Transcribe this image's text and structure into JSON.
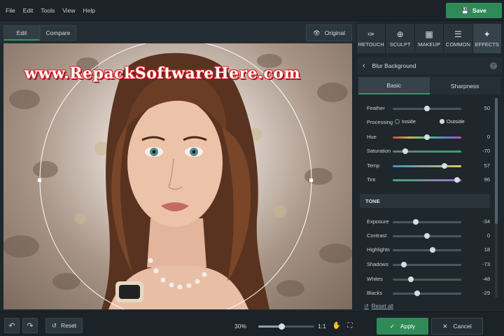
{
  "menu": [
    "File",
    "Edit",
    "Tools",
    "View",
    "Help"
  ],
  "save_label": "Save",
  "mode_tabs": {
    "edit": "Edit",
    "compare": "Compare"
  },
  "original_label": "Original",
  "watermark": "www.RepackSoftwareHere.com",
  "tools": [
    {
      "label": "RETOUCH",
      "icon": "retouch-brush-icon"
    },
    {
      "label": "SCULPT",
      "icon": "sculpt-icon"
    },
    {
      "label": "MAKEUP",
      "icon": "makeup-icon"
    },
    {
      "label": "COMMON",
      "icon": "sliders-icon"
    },
    {
      "label": "EFFECTS",
      "icon": "effects-icon"
    }
  ],
  "panel": {
    "title": "Blur Background",
    "help": "?",
    "subtabs": {
      "basic": "Basic",
      "sharpness": "Sharpness"
    },
    "feather": {
      "label": "Feather",
      "value": "50",
      "pos": 0.5
    },
    "processing": {
      "label": "Processing",
      "inside": "Inside",
      "outside": "Outside",
      "selected": "outside"
    },
    "hue": {
      "label": "Hue",
      "value": "0",
      "pos": 0.5
    },
    "saturation": {
      "label": "Saturation",
      "value": "-70",
      "pos": 0.18
    },
    "temp": {
      "label": "Temp",
      "value": "57",
      "pos": 0.75
    },
    "tint": {
      "label": "Tint",
      "value": "96",
      "pos": 0.94
    },
    "tone_header": "TONE",
    "exposure": {
      "label": "Exposure",
      "value": "-34",
      "pos": 0.34
    },
    "contrast": {
      "label": "Contrast",
      "value": "0",
      "pos": 0.5
    },
    "highlights": {
      "label": "Highlights",
      "value": "18",
      "pos": 0.58
    },
    "shadows": {
      "label": "Shadows",
      "value": "-73",
      "pos": 0.16
    },
    "whites": {
      "label": "Whites",
      "value": "-48",
      "pos": 0.27
    },
    "blacks": {
      "label": "Blacks",
      "value": "-29",
      "pos": 0.36
    },
    "reset_all": "Reset all"
  },
  "bottom": {
    "reset": "Reset",
    "zoom": "30%",
    "zoom_pos": 0.42,
    "one_to_one": "1:1",
    "apply": "Apply",
    "cancel": "Cancel"
  },
  "colors": {
    "accent": "#2e8b57",
    "background": "#1f272d"
  }
}
